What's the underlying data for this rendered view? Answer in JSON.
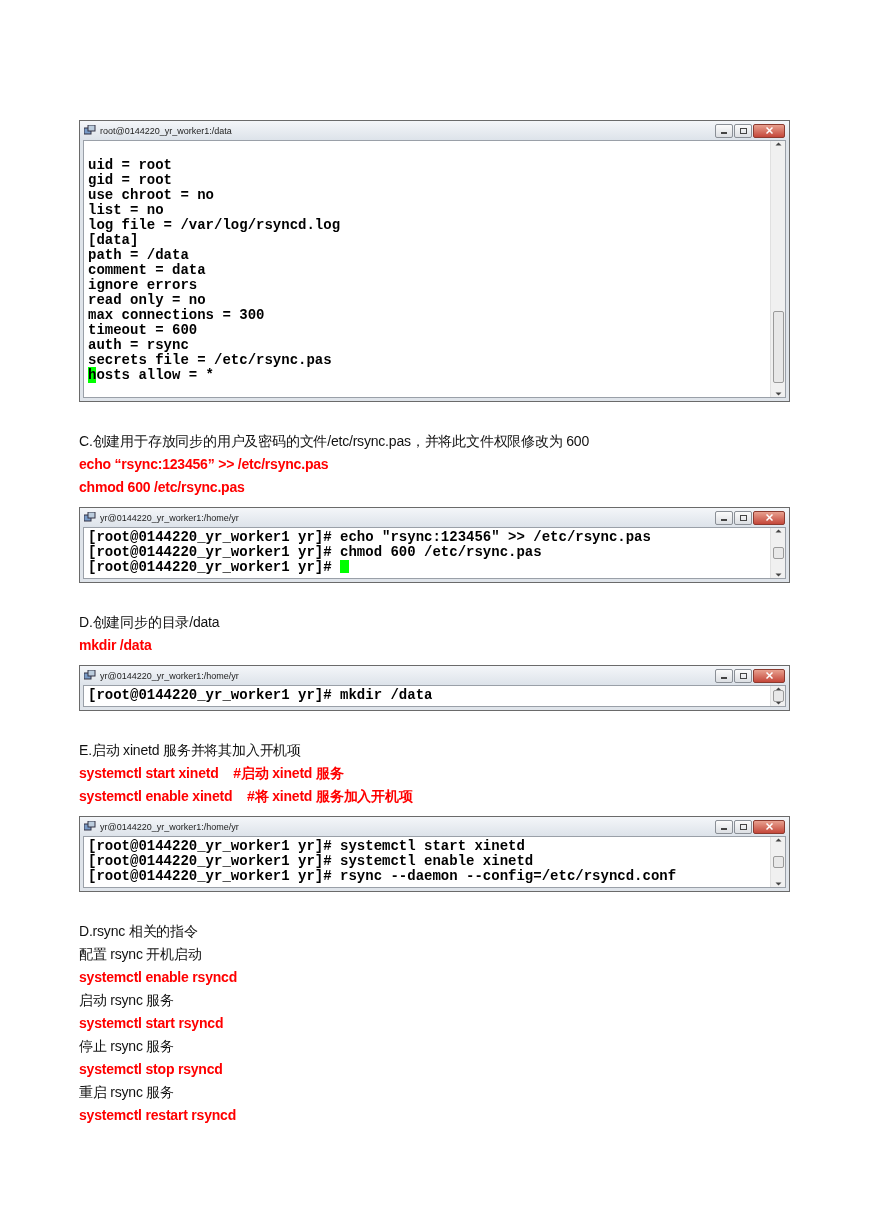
{
  "blocks": [
    {
      "kind": "terminal",
      "top_blank_line": true,
      "title": "root@0144220_yr_worker1:/data",
      "lines": [
        {
          "text": "uid = root"
        },
        {
          "text": "gid = root"
        },
        {
          "text": "use chroot = no"
        },
        {
          "text": "list = no"
        },
        {
          "text": "log file = /var/log/rsyncd.log"
        },
        {
          "text": "[data]"
        },
        {
          "text": "path = /data"
        },
        {
          "text": "comment = data"
        },
        {
          "text": "ignore errors"
        },
        {
          "text": "read only = no"
        },
        {
          "text": "max connections = 300"
        },
        {
          "text": "timeout = 600"
        },
        {
          "text": "auth = rsync"
        },
        {
          "text": "secrets file = /etc/rsync.pas"
        },
        {
          "text": "hosts allow = *",
          "cursor_on_first": true
        }
      ]
    },
    {
      "kind": "text",
      "text": "C.创建用于存放同步的用户及密码的文件/etc/rsync.pas，并将此文件权限修改为 600"
    },
    {
      "kind": "command",
      "text": "echo “rsync:123456” >> /etc/rsync.pas"
    },
    {
      "kind": "command",
      "text": "chmod 600 /etc/rsync.pas"
    },
    {
      "kind": "terminal",
      "title": "yr@0144220_yr_worker1:/home/yr",
      "lines": [
        {
          "text": "[root@0144220_yr_worker1 yr]# echo \"rsync:123456\" >> /etc/rsync.pas"
        },
        {
          "text": "[root@0144220_yr_worker1 yr]# chmod 600 /etc/rsync.pas"
        },
        {
          "text": "[root@0144220_yr_worker1 yr]# ",
          "cursor_after": true
        }
      ]
    },
    {
      "kind": "text",
      "text": "D.创建同步的目录/data"
    },
    {
      "kind": "command",
      "text": "mkdir /data"
    },
    {
      "kind": "terminal",
      "title": "yr@0144220_yr_worker1:/home/yr",
      "lines": [
        {
          "text": "[root@0144220_yr_worker1 yr]# mkdir /data"
        }
      ]
    },
    {
      "kind": "text",
      "text": "E.启动 xinetd 服务并将其加入开机项"
    },
    {
      "kind": "command",
      "text": "systemctl start xinetd    #启动 xinetd 服务"
    },
    {
      "kind": "command",
      "text": "systemctl enable xinetd    #将 xinetd 服务加入开机项"
    },
    {
      "kind": "terminal",
      "title": "yr@0144220_yr_worker1:/home/yr",
      "lines": [
        {
          "text": "[root@0144220_yr_worker1 yr]# systemctl start xinetd"
        },
        {
          "text": "[root@0144220_yr_worker1 yr]# systemctl enable xinetd"
        },
        {
          "text": "[root@0144220_yr_worker1 yr]# rsync --daemon --config=/etc/rsyncd.conf"
        }
      ]
    },
    {
      "kind": "text",
      "text": "D.rsync 相关的指令"
    },
    {
      "kind": "text",
      "text": "配置 rsync 开机启动"
    },
    {
      "kind": "command",
      "text": "systemctl enable rsyncd"
    },
    {
      "kind": "text",
      "text": "启动 rsync 服务"
    },
    {
      "kind": "command",
      "text": "systemctl start rsyncd"
    },
    {
      "kind": "text",
      "text": "停止 rsync 服务"
    },
    {
      "kind": "command",
      "text": "systemctl stop rsyncd"
    },
    {
      "kind": "text",
      "text": "重启 rsync 服务"
    },
    {
      "kind": "command",
      "text": "systemctl restart rsyncd"
    }
  ]
}
